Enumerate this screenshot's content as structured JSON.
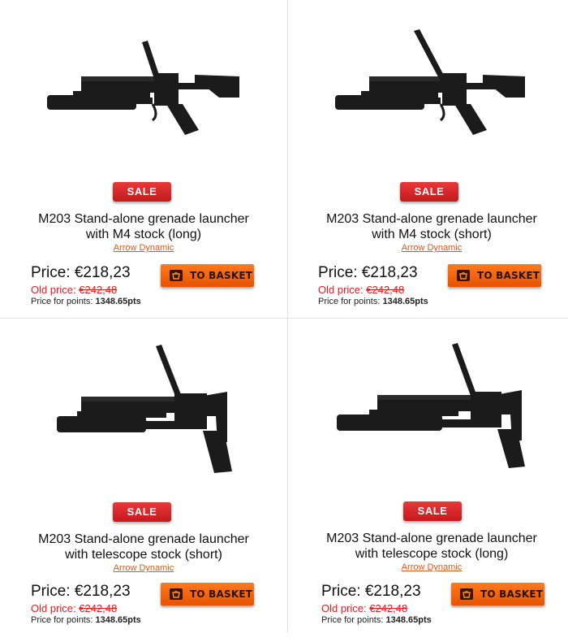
{
  "products": [
    {
      "title_line1": "M203 Stand-alone grenade launcher",
      "title_line2": "with M4 stock (long)",
      "brand": "Arrow Dynamic",
      "sale_label": "SALE",
      "price_label": "Price:",
      "price": "€218,23",
      "old_price_label": "Old price:",
      "old_price": "€242,48",
      "points_label": "Price for points:",
      "points": "1348.65pts",
      "basket_label": "TO BASKET",
      "image_icon": "grenade-launcher-m4-stock-long"
    },
    {
      "title_line1": "M203 Stand-alone grenade launcher",
      "title_line2": "with M4 stock (short)",
      "brand": "Arrow Dynamic",
      "sale_label": "SALE",
      "price_label": "Price:",
      "price": "€218,23",
      "old_price_label": "Old price:",
      "old_price": "€242,48",
      "points_label": "Price for points:",
      "points": "1348.65pts",
      "basket_label": "TO BASKET",
      "image_icon": "grenade-launcher-m4-stock-short"
    },
    {
      "title_line1": "M203 Stand-alone grenade launcher",
      "title_line2": "with telescope stock (short)",
      "brand": "Arrow Dynamic",
      "sale_label": "SALE",
      "price_label": "Price:",
      "price": "€218,23",
      "old_price_label": "Old price:",
      "old_price": "€242,48",
      "points_label": "Price for points:",
      "points": "1348.65pts",
      "basket_label": "TO BASKET",
      "image_icon": "grenade-launcher-telescope-stock-short"
    },
    {
      "title_line1": "M203 Stand-alone grenade launcher",
      "title_line2": "with telescope stock (long)",
      "brand": "Arrow Dynamic",
      "sale_label": "SALE",
      "price_label": "Price:",
      "price": "€218,23",
      "old_price_label": "Old price:",
      "old_price": "€242,48",
      "points_label": "Price for points:",
      "points": "1348.65pts",
      "basket_label": "TO BASKET",
      "image_icon": "grenade-launcher-telescope-stock-long"
    }
  ],
  "colors": {
    "sale_red": "#d32426",
    "basket_orange": "#f06a10",
    "old_price_red": "#e31b1b",
    "brand_orange": "#d85a1a",
    "divider": "#e2e2e2"
  }
}
